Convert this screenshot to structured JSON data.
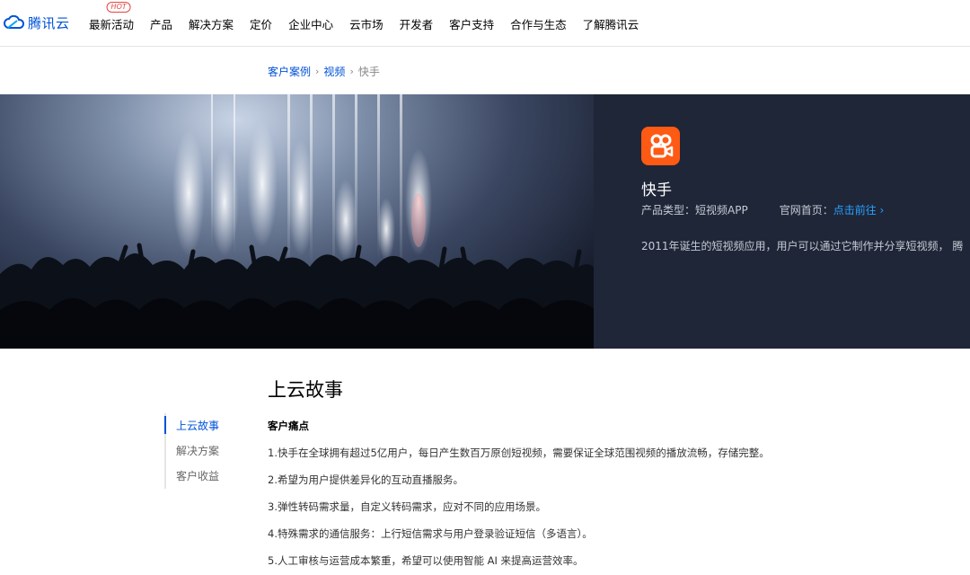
{
  "brand": {
    "logo_text": "腾讯云",
    "logo_icon": "cloud-logo-icon"
  },
  "nav": {
    "items": [
      {
        "label": "最新活动",
        "badge": "HOT"
      },
      {
        "label": "产品"
      },
      {
        "label": "解决方案"
      },
      {
        "label": "定价"
      },
      {
        "label": "企业中心"
      },
      {
        "label": "云市场"
      },
      {
        "label": "开发者"
      },
      {
        "label": "客户支持"
      },
      {
        "label": "合作与生态"
      },
      {
        "label": "了解腾讯云"
      }
    ]
  },
  "breadcrumb": {
    "item1": "客户案例",
    "item2": "视频",
    "current": "快手"
  },
  "hero": {
    "app_name": "快手",
    "product_type": "产品类型：短视频APP",
    "official_label": "官网首页：",
    "official_link": "点击前往",
    "description": "2011年诞生的短视频应用，用户可以通过它制作并分享短视频， 腾",
    "icon": "kuaishou-app-icon",
    "colors": {
      "background": "#1f2638",
      "icon_bg": "#fe5a14",
      "link": "#29a1ff"
    }
  },
  "content": {
    "title": "上云故事",
    "side_nav": [
      "上云故事",
      "解决方案",
      "客户收益"
    ],
    "pain_title": "客户痛点",
    "pain_points": [
      "1.快手在全球拥有超过5亿用户，每日产生数百万原创短视频，需要保证全球范围视频的播放流畅，存储完整。",
      "2.希望为用户提供差异化的互动直播服务。",
      "3.弹性转码需求量，自定义转码需求，应对不同的应用场景。",
      "4.特殊需求的通信服务：上行短信需求与用户登录验证短信（多语言）。",
      "5.人工审核与运营成本繁重，希望可以使用智能 AI 来提高运营效率。"
    ]
  },
  "accent_color": "#0052d9"
}
